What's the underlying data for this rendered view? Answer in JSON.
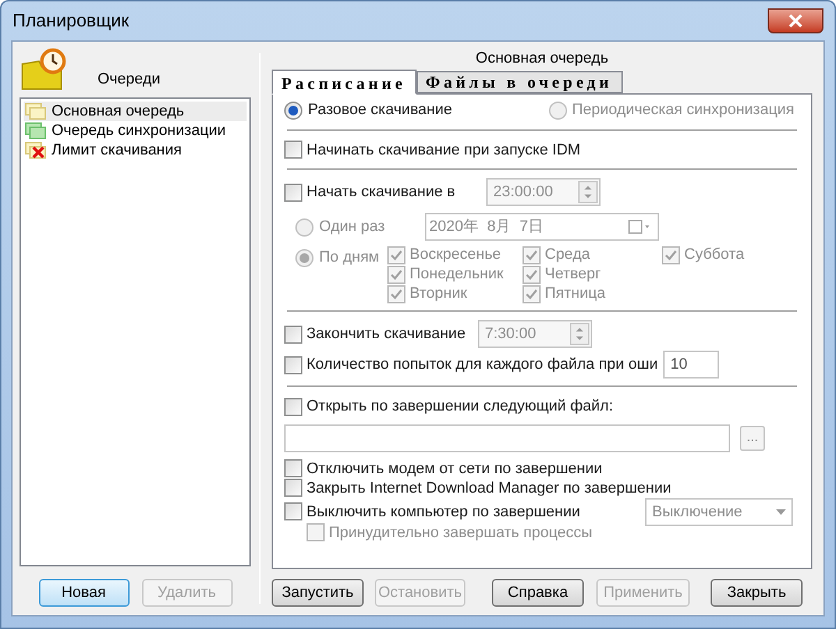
{
  "window": {
    "title": "Планировщик"
  },
  "queues": {
    "title": "Очереди",
    "items": [
      {
        "label": "Основная очередь",
        "kind": "main",
        "selected": true
      },
      {
        "label": "Очередь синхронизации",
        "kind": "sync",
        "selected": false
      },
      {
        "label": "Лимит скачивания",
        "kind": "limit",
        "selected": false
      }
    ],
    "buttons": [
      {
        "label": "Новая",
        "disabled": false,
        "default": true
      },
      {
        "label": "Удалить",
        "disabled": true,
        "default": false
      }
    ]
  },
  "queue_title": "Основная очередь",
  "tabs": [
    {
      "label": "Расписание",
      "selected": true
    },
    {
      "label": "Файлы в очереди",
      "selected": false
    }
  ],
  "mode": [
    {
      "label": "Разовое скачивание",
      "selected": true,
      "disabled": false
    },
    {
      "label": "Периодическая синхронизация",
      "selected": false,
      "disabled": true
    }
  ],
  "start_on_launch": {
    "label": "Начинать скачивание при запуске IDM",
    "checked": false,
    "disabled": false
  },
  "start_at": {
    "label": "Начать скачивание в",
    "checked": false,
    "disabled": false,
    "time": "23:00:00"
  },
  "once": {
    "label": "Один раз",
    "selected": false,
    "disabled": true,
    "date": "2020年  8月  7日"
  },
  "by_days": {
    "label": "По дням",
    "selected": true,
    "disabled": true,
    "days": [
      {
        "label": "Воскресенье",
        "checked": true
      },
      {
        "label": "Понедельник",
        "checked": true
      },
      {
        "label": "Вторник",
        "checked": true
      },
      {
        "label": "Среда",
        "checked": true
      },
      {
        "label": "Четверг",
        "checked": true
      },
      {
        "label": "Пятница",
        "checked": true
      },
      {
        "label": "Суббота",
        "checked": true
      }
    ]
  },
  "stop_at": {
    "label": "Закончить скачивание",
    "checked": false,
    "disabled": false,
    "time": "7:30:00"
  },
  "retries": {
    "label": "Количество попыток для каждого файла при оши",
    "checked": false,
    "disabled": false,
    "value": "10"
  },
  "open_file": {
    "label": "Открыть по завершении следующий файл:",
    "checked": false,
    "disabled": false,
    "browse": "..."
  },
  "after": [
    {
      "label": "Отключить модем от сети по завершении",
      "checked": false,
      "disabled": false
    },
    {
      "label": "Закрыть Internet Download Manager по завершении",
      "checked": false,
      "disabled": false
    },
    {
      "label": "Выключить компьютер по завершении",
      "checked": false,
      "disabled": false
    }
  ],
  "shutdown_mode": "Выключение",
  "force_close": {
    "label": "Принудительно завершать процессы",
    "checked": false,
    "disabled": true
  },
  "buttons": [
    {
      "label": "Запустить",
      "disabled": false
    },
    {
      "label": "Остановить",
      "disabled": true
    },
    {
      "label": "Справка",
      "disabled": false
    },
    {
      "label": "Применить",
      "disabled": true
    },
    {
      "label": "Закрыть",
      "disabled": false
    }
  ]
}
